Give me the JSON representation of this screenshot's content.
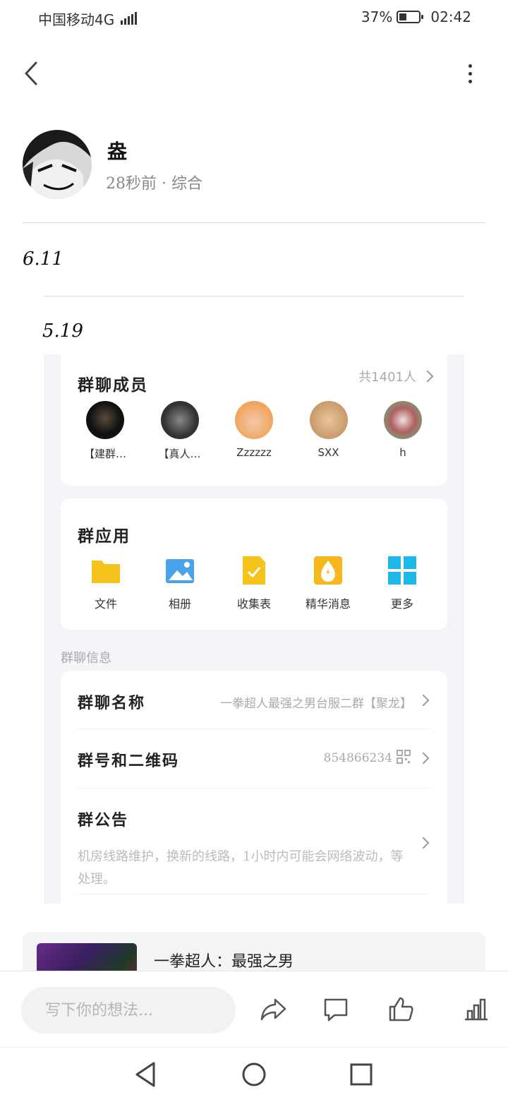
{
  "status_bar": {
    "carrier": "中国移动4G",
    "battery": "37%",
    "time": "02:42"
  },
  "post": {
    "author": "盎",
    "meta": "28秒前 · 综合",
    "text1": "6.11",
    "text2": "5.19"
  },
  "screenshot": {
    "members": {
      "title": "群聊成员",
      "count": "共1401人",
      "list": [
        "【建群…",
        "【真人…",
        "Zzzzzz",
        "SXX",
        "h"
      ]
    },
    "apps": {
      "title": "群应用",
      "list": [
        "文件",
        "相册",
        "收集表",
        "精华消息",
        "更多"
      ]
    },
    "info": {
      "section_label": "群聊信息",
      "name_label": "群聊名称",
      "name_value": "一拳超人最强之男台服二群【聚龙】",
      "number_label": "群号和二维码",
      "number_value": "854866234",
      "notice_label": "群公告",
      "notice_text": "机房线路维护，换新的线路，1小时内可能会网络波动，等处理。"
    }
  },
  "link_card": {
    "title": "一拳超人：最强之男"
  },
  "bottom_bar": {
    "placeholder": "写下你的想法..."
  },
  "colors": {
    "folder": "#f6c21c",
    "album": "#4aa3e8",
    "form": "#f6c21c",
    "essence": "#f6b81c",
    "more": "#1eb7e6"
  }
}
